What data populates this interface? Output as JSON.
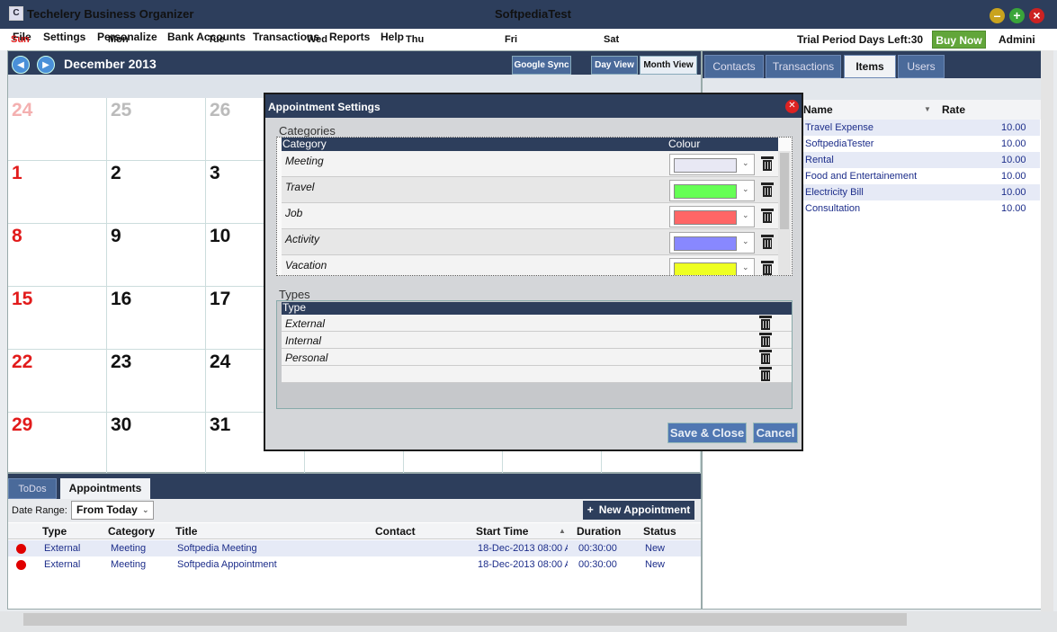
{
  "app": {
    "name": "Techelery Business Organizer",
    "window_title": "SoftpediaTest",
    "icon_label": "C"
  },
  "menu": [
    "File",
    "Settings",
    "Personalize",
    "Bank Accounts",
    "Transactions",
    "Reports",
    "Help"
  ],
  "trial_text": "Trial Period Days Left:30",
  "buy_now": "Buy Now",
  "user": "Admini",
  "calendar": {
    "month_label": "December 2013",
    "views": [
      "Google Sync",
      "Day View",
      "Month View"
    ],
    "weekdays": [
      "Sun",
      "Mon",
      "Tue",
      "Wed",
      "Thu",
      "Fri",
      "Sat"
    ],
    "weeks": [
      [
        "24",
        "25",
        "26"
      ],
      [
        "1",
        "2",
        "3"
      ],
      [
        "8",
        "9",
        "10"
      ],
      [
        "15",
        "16",
        "17"
      ],
      [
        "22",
        "23",
        "24"
      ],
      [
        "29",
        "30",
        "31"
      ]
    ]
  },
  "bottom": {
    "tabs": [
      "ToDos",
      "Appointments"
    ],
    "date_range_label": "Date Range:",
    "date_range_value": "From Today",
    "new_appointment": "New Appointment",
    "columns": [
      "Type",
      "Category",
      "Title",
      "Contact",
      "Start Time",
      "Duration",
      "Status"
    ],
    "rows": [
      {
        "type": "External",
        "category": "Meeting",
        "title": "Softpedia Meeting",
        "contact": "",
        "start": "18-Dec-2013 08:00 A",
        "duration": "00:30:00",
        "status": "New"
      },
      {
        "type": "External",
        "category": "Meeting",
        "title": "Softpedia Appointment",
        "contact": "",
        "start": "18-Dec-2013 08:00 A",
        "duration": "00:30:00",
        "status": "New"
      }
    ]
  },
  "right": {
    "tabs": [
      "Contacts",
      "Transactions",
      "Items",
      "Users"
    ],
    "columns": [
      "Name",
      "Rate"
    ],
    "items": [
      {
        "name": "Travel Expense",
        "rate": "10.00"
      },
      {
        "name": "SoftpediaTester",
        "rate": "10.00"
      },
      {
        "name": "Rental",
        "rate": "10.00"
      },
      {
        "name": "Food and Entertainement",
        "rate": "10.00"
      },
      {
        "name": "Electricity Bill",
        "rate": "10.00"
      },
      {
        "name": "Consultation",
        "rate": "10.00"
      }
    ]
  },
  "modal": {
    "title": "Appointment Settings",
    "categories_label": "Categories",
    "category_col": "Category",
    "colour_col": "Colour",
    "categories": [
      {
        "name": "Meeting",
        "color": "#e8e8f4"
      },
      {
        "name": "Travel",
        "color": "#66ff55"
      },
      {
        "name": "Job",
        "color": "#ff6666"
      },
      {
        "name": "Activity",
        "color": "#8888ff"
      },
      {
        "name": "Vacation",
        "color": "#eeff22"
      }
    ],
    "types_label": "Types",
    "type_col": "Type",
    "types": [
      "External",
      "Internal",
      "Personal",
      ""
    ],
    "save_close": "Save & Close",
    "cancel": "Cancel"
  },
  "colors": {
    "header": "#2d3e5c",
    "sunday": "#e21b1b",
    "accent": "#4a90d8",
    "link": "#1c2d8a"
  }
}
